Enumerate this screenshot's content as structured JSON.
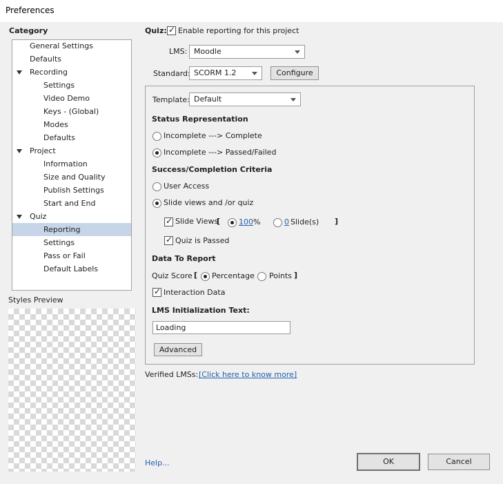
{
  "window": {
    "title": "Preferences"
  },
  "sidebar": {
    "heading": "Category",
    "items": [
      {
        "label": "General Settings",
        "level": 1,
        "expander": false,
        "selected": false
      },
      {
        "label": "Defaults",
        "level": 1,
        "expander": false,
        "selected": false
      },
      {
        "label": "Recording",
        "level": 1,
        "expander": true,
        "selected": false
      },
      {
        "label": "Settings",
        "level": 2,
        "expander": false,
        "selected": false
      },
      {
        "label": "Video Demo",
        "level": 2,
        "expander": false,
        "selected": false
      },
      {
        "label": "Keys - (Global)",
        "level": 2,
        "expander": false,
        "selected": false
      },
      {
        "label": "Modes",
        "level": 2,
        "expander": false,
        "selected": false
      },
      {
        "label": "Defaults",
        "level": 2,
        "expander": false,
        "selected": false
      },
      {
        "label": "Project",
        "level": 1,
        "expander": true,
        "selected": false
      },
      {
        "label": "Information",
        "level": 2,
        "expander": false,
        "selected": false
      },
      {
        "label": "Size and Quality",
        "level": 2,
        "expander": false,
        "selected": false
      },
      {
        "label": "Publish Settings",
        "level": 2,
        "expander": false,
        "selected": false
      },
      {
        "label": "Start and End",
        "level": 2,
        "expander": false,
        "selected": false
      },
      {
        "label": "Quiz",
        "level": 1,
        "expander": true,
        "selected": false
      },
      {
        "label": "Reporting",
        "level": 2,
        "expander": false,
        "selected": true
      },
      {
        "label": "Settings",
        "level": 2,
        "expander": false,
        "selected": false
      },
      {
        "label": "Pass or Fail",
        "level": 2,
        "expander": false,
        "selected": false
      },
      {
        "label": "Default Labels",
        "level": 2,
        "expander": false,
        "selected": false
      }
    ],
    "styles_preview_label": "Styles Preview"
  },
  "main": {
    "quiz_label": "Quiz:",
    "enable_reporting": {
      "label": "Enable reporting for this project",
      "checked": true
    },
    "lms": {
      "label": "LMS:",
      "value": "Moodle"
    },
    "standard": {
      "label": "Standard:",
      "value": "SCORM 1.2"
    },
    "configure_button": "Configure",
    "template": {
      "label": "Template:",
      "value": "Default"
    },
    "status_representation": {
      "heading": "Status Representation",
      "option_complete": {
        "label": "Incomplete ---> Complete",
        "selected": false
      },
      "option_passed": {
        "label": "Incomplete ---> Passed/Failed",
        "selected": true
      }
    },
    "success_criteria": {
      "heading": "Success/Completion Criteria",
      "user_access": {
        "label": "User Access",
        "selected": false
      },
      "slide_views_quiz": {
        "label": "Slide views and /or quiz",
        "selected": true
      },
      "slide_views": {
        "label": "Slide Views",
        "checked": true,
        "open_bracket": "[",
        "percent_value": "100",
        "percent_sign": "%",
        "percent_selected": true,
        "slides_value": "0",
        "slides_label": "Slide(s)",
        "slides_selected": false,
        "close_bracket": "]"
      },
      "quiz_passed": {
        "label": "Quiz is Passed",
        "checked": true
      }
    },
    "data_to_report": {
      "heading": "Data To Report",
      "quiz_score_label": "Quiz Score",
      "open_bracket": "[",
      "percentage": {
        "label": "Percentage",
        "selected": true
      },
      "points": {
        "label": "Points",
        "selected": false
      },
      "close_bracket": "]",
      "interaction_data": {
        "label": "Interaction Data",
        "checked": true
      }
    },
    "lms_init": {
      "label": "LMS Initialization Text:",
      "value": "Loading"
    },
    "advanced_button": "Advanced",
    "verified_lms_label": "Verified LMSs:",
    "verified_lms_link": "[Click here to know more]"
  },
  "footer": {
    "help_link": "Help...",
    "ok_button": "OK",
    "cancel_button": "Cancel"
  },
  "colors": {
    "window_bg": "#f0f0f0",
    "selection": "#c7d5e8",
    "link": "#2060b0"
  }
}
